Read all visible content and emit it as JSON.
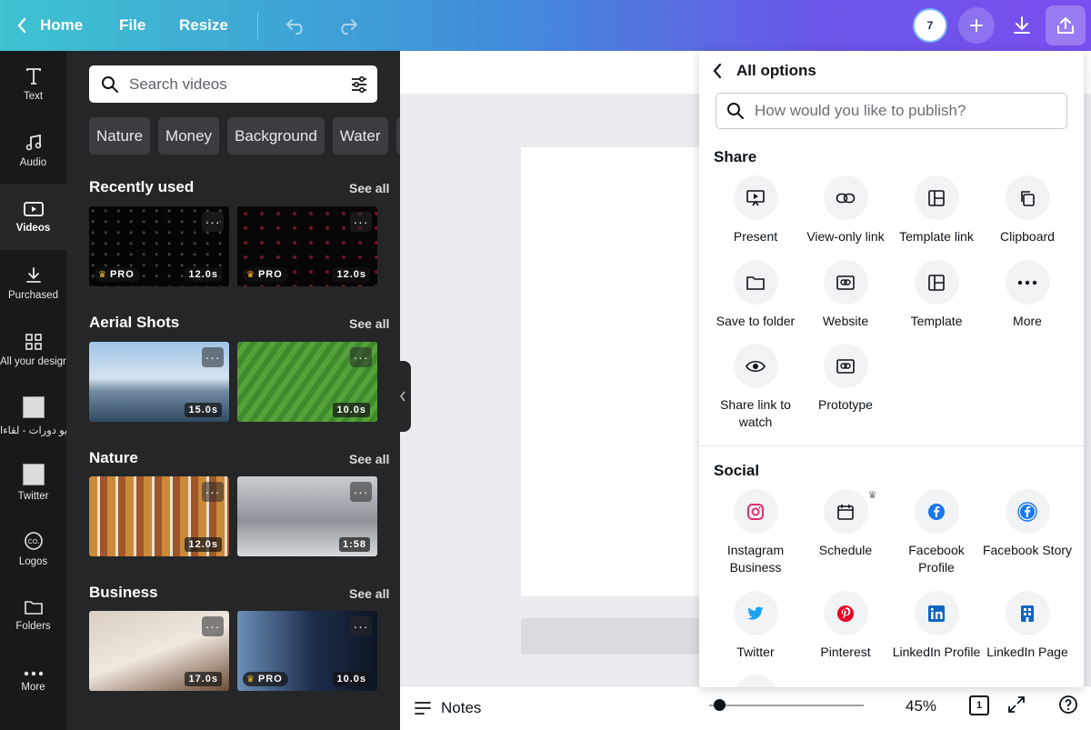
{
  "topbar": {
    "home_label": "Home",
    "file_label": "File",
    "resize_label": "Resize",
    "avatar_text": "7"
  },
  "rail": {
    "items": [
      {
        "label": "Text",
        "icon": "text-icon"
      },
      {
        "label": "Audio",
        "icon": "music-note-icon"
      },
      {
        "label": "Videos",
        "icon": "video-icon"
      },
      {
        "label": "Purchased",
        "icon": "download-icon"
      },
      {
        "label": "All your designs",
        "icon": "grid-icon"
      },
      {
        "label": "فيديو دورات - لقاءا",
        "icon": "design-thumbnail"
      },
      {
        "label": "Twitter",
        "icon": "design-thumbnail"
      },
      {
        "label": "Logos",
        "icon": "logo-icon"
      },
      {
        "label": "Folders",
        "icon": "folder-icon"
      },
      {
        "label": "More",
        "icon": "more-icon"
      }
    ]
  },
  "panel": {
    "search_placeholder": "Search videos",
    "chips": [
      "Nature",
      "Money",
      "Background",
      "Water"
    ],
    "see_all": "See all",
    "sections": [
      {
        "title": "Recently used",
        "videos": [
          {
            "duration": "12.0s",
            "pro": "PRO"
          },
          {
            "duration": "12.0s",
            "pro": "PRO"
          }
        ]
      },
      {
        "title": "Aerial Shots",
        "videos": [
          {
            "duration": "15.0s",
            "pro": ""
          },
          {
            "duration": "10.0s",
            "pro": ""
          }
        ]
      },
      {
        "title": "Nature",
        "videos": [
          {
            "duration": "12.0s",
            "pro": ""
          },
          {
            "duration": "1:58",
            "pro": ""
          }
        ]
      },
      {
        "title": "Business",
        "videos": [
          {
            "duration": "17.0s",
            "pro": ""
          },
          {
            "duration": "10.0s",
            "pro": "PRO"
          }
        ]
      }
    ]
  },
  "bottombar": {
    "notes_label": "Notes",
    "zoom": "45%",
    "page_count": "1"
  },
  "publish": {
    "back_title": "All options",
    "search_placeholder": "How would you like to publish?",
    "share_title": "Share",
    "share_options": [
      {
        "label": "Present",
        "icon": "present-icon"
      },
      {
        "label": "View-only link",
        "icon": "link-icon"
      },
      {
        "label": "Template link",
        "icon": "template-icon"
      },
      {
        "label": "Clipboard",
        "icon": "clipboard-icon"
      },
      {
        "label": "Save to folder",
        "icon": "folder-icon"
      },
      {
        "label": "Website",
        "icon": "website-icon"
      },
      {
        "label": "Template",
        "icon": "template-icon"
      },
      {
        "label": "More",
        "icon": "more-icon"
      },
      {
        "label": "Share link to watch",
        "icon": "eye-icon"
      },
      {
        "label": "Prototype",
        "icon": "website-icon"
      }
    ],
    "social_title": "Social",
    "social_options": [
      {
        "label": "Instagram Business",
        "icon": "instagram-icon"
      },
      {
        "label": "Schedule",
        "icon": "calendar-icon"
      },
      {
        "label": "Facebook Profile",
        "icon": "facebook-icon"
      },
      {
        "label": "Facebook Story",
        "icon": "facebook-icon"
      },
      {
        "label": "Twitter",
        "icon": "twitter-icon"
      },
      {
        "label": "Pinterest",
        "icon": "pinterest-icon"
      },
      {
        "label": "LinkedIn Profile",
        "icon": "linkedin-icon"
      },
      {
        "label": "LinkedIn Page",
        "icon": "linkedin-icon"
      }
    ]
  },
  "colors": {
    "accent": "#7a4ff0",
    "panel_bg": "#252627",
    "rail_bg": "#18191b",
    "facebook": "#1877f2",
    "instagram": "#e1306c",
    "twitter": "#1da1f2",
    "pinterest": "#e60023",
    "linkedin": "#0a66c2"
  }
}
